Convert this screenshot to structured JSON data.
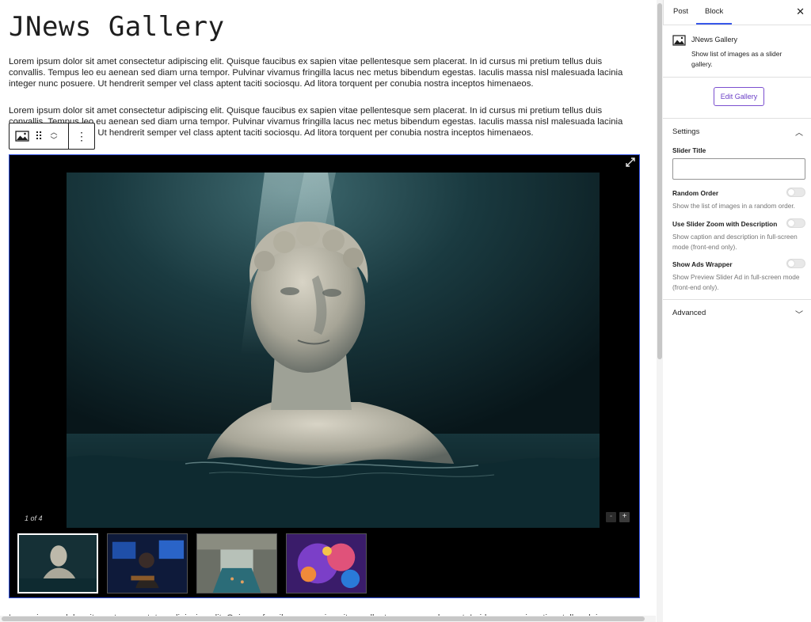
{
  "post": {
    "title": "JNews Gallery",
    "paragraph_1": "Lorem ipsum dolor sit amet consectetur adipiscing elit. Quisque faucibus ex sapien vitae pellentesque sem placerat. In id cursus mi pretium tellus duis convallis. Tempus leo eu aenean sed diam urna tempor. Pulvinar vivamus fringilla lacus nec metus bibendum egestas. Iaculis massa nisl malesuada lacinia integer nunc posuere. Ut hendrerit semper vel class aptent taciti sociosqu. Ad litora torquent per conubia nostra inceptos himenaeos.",
    "paragraph_2": "Lorem ipsum dolor sit amet consectetur adipiscing elit. Quisque faucibus ex sapien vitae pellentesque sem placerat. In id cursus mi pretium tellus duis convallis. Tempus leo eu aenean sed diam urna tempor. Pulvinar vivamus fringilla lacus nec metus bibendum egestas. Iaculis massa nisl malesuada lacinia integer nunc posuere. Ut hendrerit semper vel class aptent taciti sociosqu. Ad litora torquent per conubia nostra inceptos himenaeos.",
    "paragraph_3": "Lorem ipsum dolor sit amet consectetur adipiscing elit. Quisque faucibus ex sapien vitae pellentesque sem placerat. In id cursus mi pretium tellus duis convallis."
  },
  "toolbar": {
    "block_icon": "gallery-icon",
    "drag_icon": "drag-handle-icon",
    "move_up_icon": "chevron-up-icon",
    "move_down_icon": "chevron-down-icon",
    "more_icon": "more-vertical-icon"
  },
  "gallery": {
    "counter": "1 of 4",
    "zoom_out": "-",
    "zoom_in": "+",
    "expand_icon": "fullscreen-icon",
    "current_index": 1,
    "total": 4
  },
  "sidebar": {
    "tabs": [
      {
        "label": "Post",
        "active": false
      },
      {
        "label": "Block",
        "active": true
      }
    ],
    "close_icon": "close-icon",
    "block": {
      "name": "JNews Gallery",
      "description": "Show list of images as a slider gallery.",
      "icon": "gallery-icon"
    },
    "edit_button": "Edit Gallery",
    "settings": {
      "title": "Settings",
      "expanded": true,
      "slider_title_label": "Slider Title",
      "slider_title_value": "",
      "random_order": {
        "label": "Random Order",
        "help": "Show the list of images in a random order.",
        "on": false
      },
      "zoom_desc": {
        "label": "Use Slider Zoom with Description",
        "help": "Show caption and description in full-screen mode (front-end only).",
        "on": false
      },
      "ads_wrapper": {
        "label": "Show Ads Wrapper",
        "help": "Show Preview Slider Ad in full-screen mode (front-end only).",
        "on": false
      }
    },
    "advanced": {
      "title": "Advanced",
      "expanded": false
    }
  },
  "colors": {
    "accent": "#3858e9",
    "button_purple": "#6b3fc7",
    "gallery_bg": "#000000"
  }
}
